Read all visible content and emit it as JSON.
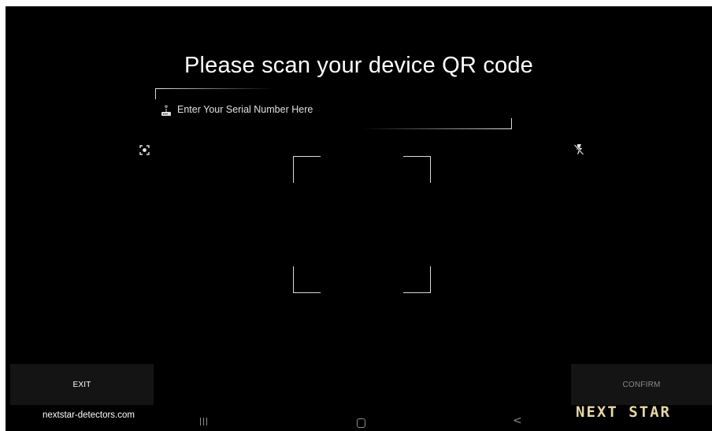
{
  "scanner": {
    "title": "Please scan your device QR code",
    "serial_placeholder": "Enter Your Serial Number Here",
    "serial_value": "",
    "serial_icon": "router-device-icon",
    "focus_icon": "focus-target-icon",
    "flash_icon": "flash-off-icon"
  },
  "actions": {
    "exit_label": "EXIT",
    "confirm_label": "CONFIRM"
  },
  "footer": {
    "website": "nextstar-detectors.com",
    "brand": "NEXT STAR"
  },
  "system_nav": {
    "recent_icon": "recent-apps-icon",
    "home_icon": "home-icon",
    "back_icon": "back-icon",
    "back_glyph": "<"
  },
  "colors": {
    "background": "#000000",
    "button_bg": "#141414",
    "brand": "#e8d7a6",
    "confirm_text_disabled": "#8a8a8a"
  }
}
